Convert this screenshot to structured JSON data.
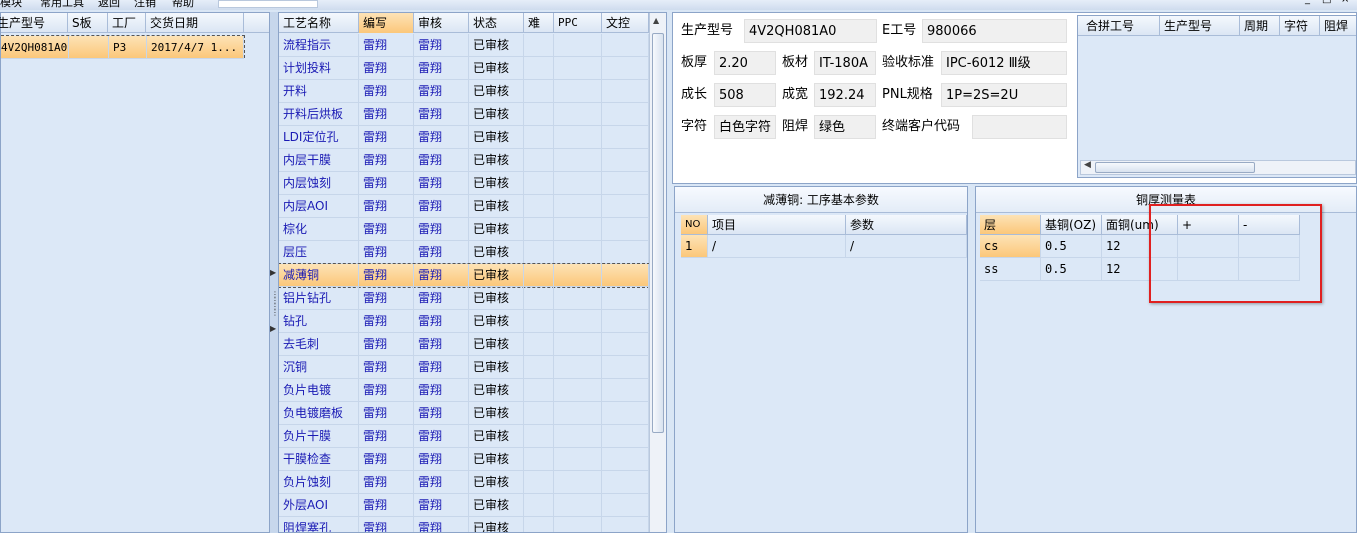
{
  "menu": {
    "items": [
      "模块",
      "常用工具",
      "返回",
      "注销",
      "帮助"
    ],
    "window_controls": [
      "_",
      "□",
      "×"
    ]
  },
  "left_grid": {
    "columns": [
      "生产型号",
      "S板",
      "工厂",
      "交货日期"
    ],
    "rows": [
      {
        "model": "4V2QH081A0",
        "s": "",
        "factory": "P3",
        "date": "2017/4/7 1..."
      }
    ]
  },
  "process_grid": {
    "columns": [
      "工艺名称",
      "编写",
      "审核",
      "状态",
      "难",
      "PPC",
      "文控"
    ],
    "rows": [
      {
        "name": "流程指示",
        "writer": "雷翔",
        "reviewer": "雷翔",
        "status": "已审核"
      },
      {
        "name": "计划投料",
        "writer": "雷翔",
        "reviewer": "雷翔",
        "status": "已审核"
      },
      {
        "name": "开料",
        "writer": "雷翔",
        "reviewer": "雷翔",
        "status": "已审核"
      },
      {
        "name": "开料后烘板",
        "writer": "雷翔",
        "reviewer": "雷翔",
        "status": "已审核"
      },
      {
        "name": "LDI定位孔",
        "writer": "雷翔",
        "reviewer": "雷翔",
        "status": "已审核"
      },
      {
        "name": "内层干膜",
        "writer": "雷翔",
        "reviewer": "雷翔",
        "status": "已审核"
      },
      {
        "name": "内层蚀刻",
        "writer": "雷翔",
        "reviewer": "雷翔",
        "status": "已审核"
      },
      {
        "name": "内层AOI",
        "writer": "雷翔",
        "reviewer": "雷翔",
        "status": "已审核"
      },
      {
        "name": "棕化",
        "writer": "雷翔",
        "reviewer": "雷翔",
        "status": "已审核"
      },
      {
        "name": "层压",
        "writer": "雷翔",
        "reviewer": "雷翔",
        "status": "已审核"
      },
      {
        "name": "减薄铜",
        "writer": "雷翔",
        "reviewer": "雷翔",
        "status": "已审核"
      },
      {
        "name": "铝片钻孔",
        "writer": "雷翔",
        "reviewer": "雷翔",
        "status": "已审核"
      },
      {
        "name": "钻孔",
        "writer": "雷翔",
        "reviewer": "雷翔",
        "status": "已审核"
      },
      {
        "name": "去毛刺",
        "writer": "雷翔",
        "reviewer": "雷翔",
        "status": "已审核"
      },
      {
        "name": "沉铜",
        "writer": "雷翔",
        "reviewer": "雷翔",
        "status": "已审核"
      },
      {
        "name": "负片电镀",
        "writer": "雷翔",
        "reviewer": "雷翔",
        "status": "已审核"
      },
      {
        "name": "负电镀磨板",
        "writer": "雷翔",
        "reviewer": "雷翔",
        "status": "已审核"
      },
      {
        "name": "负片干膜",
        "writer": "雷翔",
        "reviewer": "雷翔",
        "status": "已审核"
      },
      {
        "name": "干膜检查",
        "writer": "雷翔",
        "reviewer": "雷翔",
        "status": "已审核"
      },
      {
        "name": "负片蚀刻",
        "writer": "雷翔",
        "reviewer": "雷翔",
        "status": "已审核"
      },
      {
        "name": "外层AOI",
        "writer": "雷翔",
        "reviewer": "雷翔",
        "status": "已审核"
      },
      {
        "name": "阻焊塞孔",
        "writer": "雷翔",
        "reviewer": "雷翔",
        "status": "已审核"
      }
    ],
    "selected_index": 10
  },
  "info": {
    "model_label": "生产型号",
    "model": "4V2QH081A0",
    "e_no_label": "E工号",
    "e_no": "980066",
    "thickness_label": "板厚",
    "thickness": "2.20",
    "material_label": "板材",
    "material": "IT-180A",
    "standard_label": "验收标准",
    "standard": "IPC-6012 Ⅲ级",
    "length_label": "成长",
    "length": "508",
    "width_label": "成宽",
    "width": "192.24",
    "pnl_label": "PNL规格",
    "pnl": "1P=2S=2U",
    "char_label": "字符",
    "char": "白色字符",
    "mask_label": "阻焊",
    "mask": "绿色",
    "customer_code_label": "终端客户代码",
    "customer_code": ""
  },
  "merge_table": {
    "columns": [
      "合拼工号",
      "生产型号",
      "周期",
      "字符",
      "阻焊"
    ]
  },
  "thin_copper": {
    "title": "减薄铜: 工序基本参数",
    "columns": [
      "NO",
      "项目",
      "参数"
    ],
    "rows": [
      {
        "no": "1",
        "item": "/",
        "param": "/"
      }
    ]
  },
  "copper_table": {
    "title": "铜厚测量表",
    "columns": [
      "层",
      "基铜(OZ)",
      "面铜(um)",
      "+",
      "-"
    ],
    "rows": [
      {
        "layer": "cs",
        "base": "0.5",
        "face": "12",
        "plus": "",
        "minus": ""
      },
      {
        "layer": "ss",
        "base": "0.5",
        "face": "12",
        "plus": "",
        "minus": ""
      }
    ]
  }
}
